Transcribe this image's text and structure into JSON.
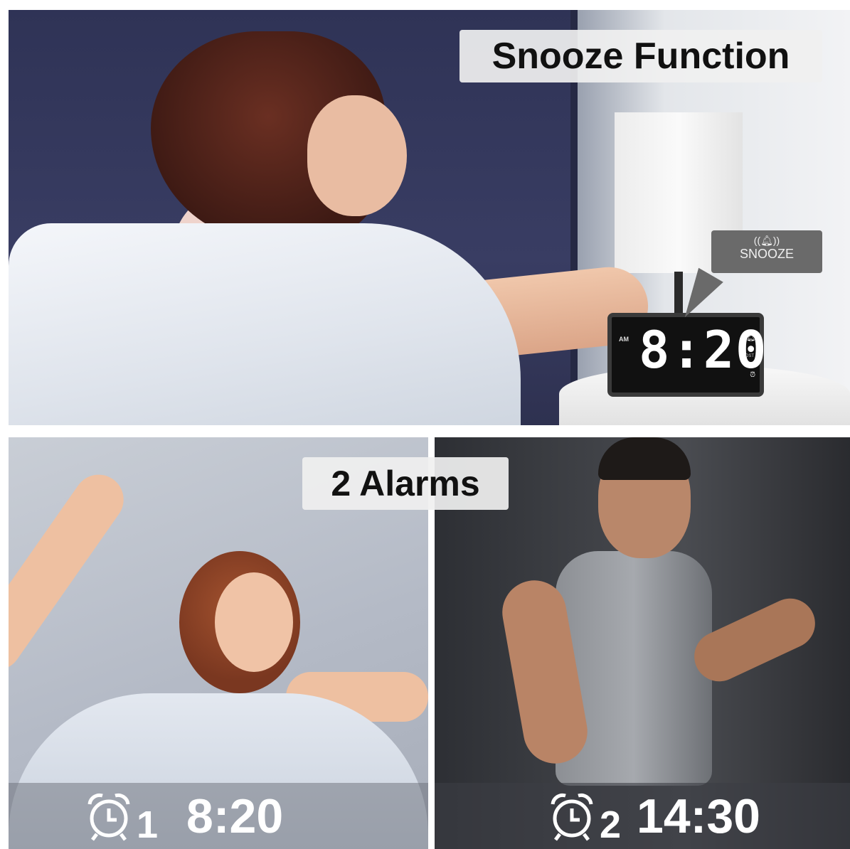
{
  "top_panel": {
    "title": "Snooze Function",
    "callout_label": "SNOOZE",
    "clock": {
      "ampm": "AM",
      "time": "8:20",
      "dst": "DST"
    }
  },
  "bottom_panels": {
    "title": "2 Alarms",
    "alarm1": {
      "number": "1",
      "time": "8:20"
    },
    "alarm2": {
      "number": "2",
      "time": "14:30"
    }
  },
  "colors": {
    "headboard": "#393d63",
    "overlay_bar": "#5a5f69"
  }
}
